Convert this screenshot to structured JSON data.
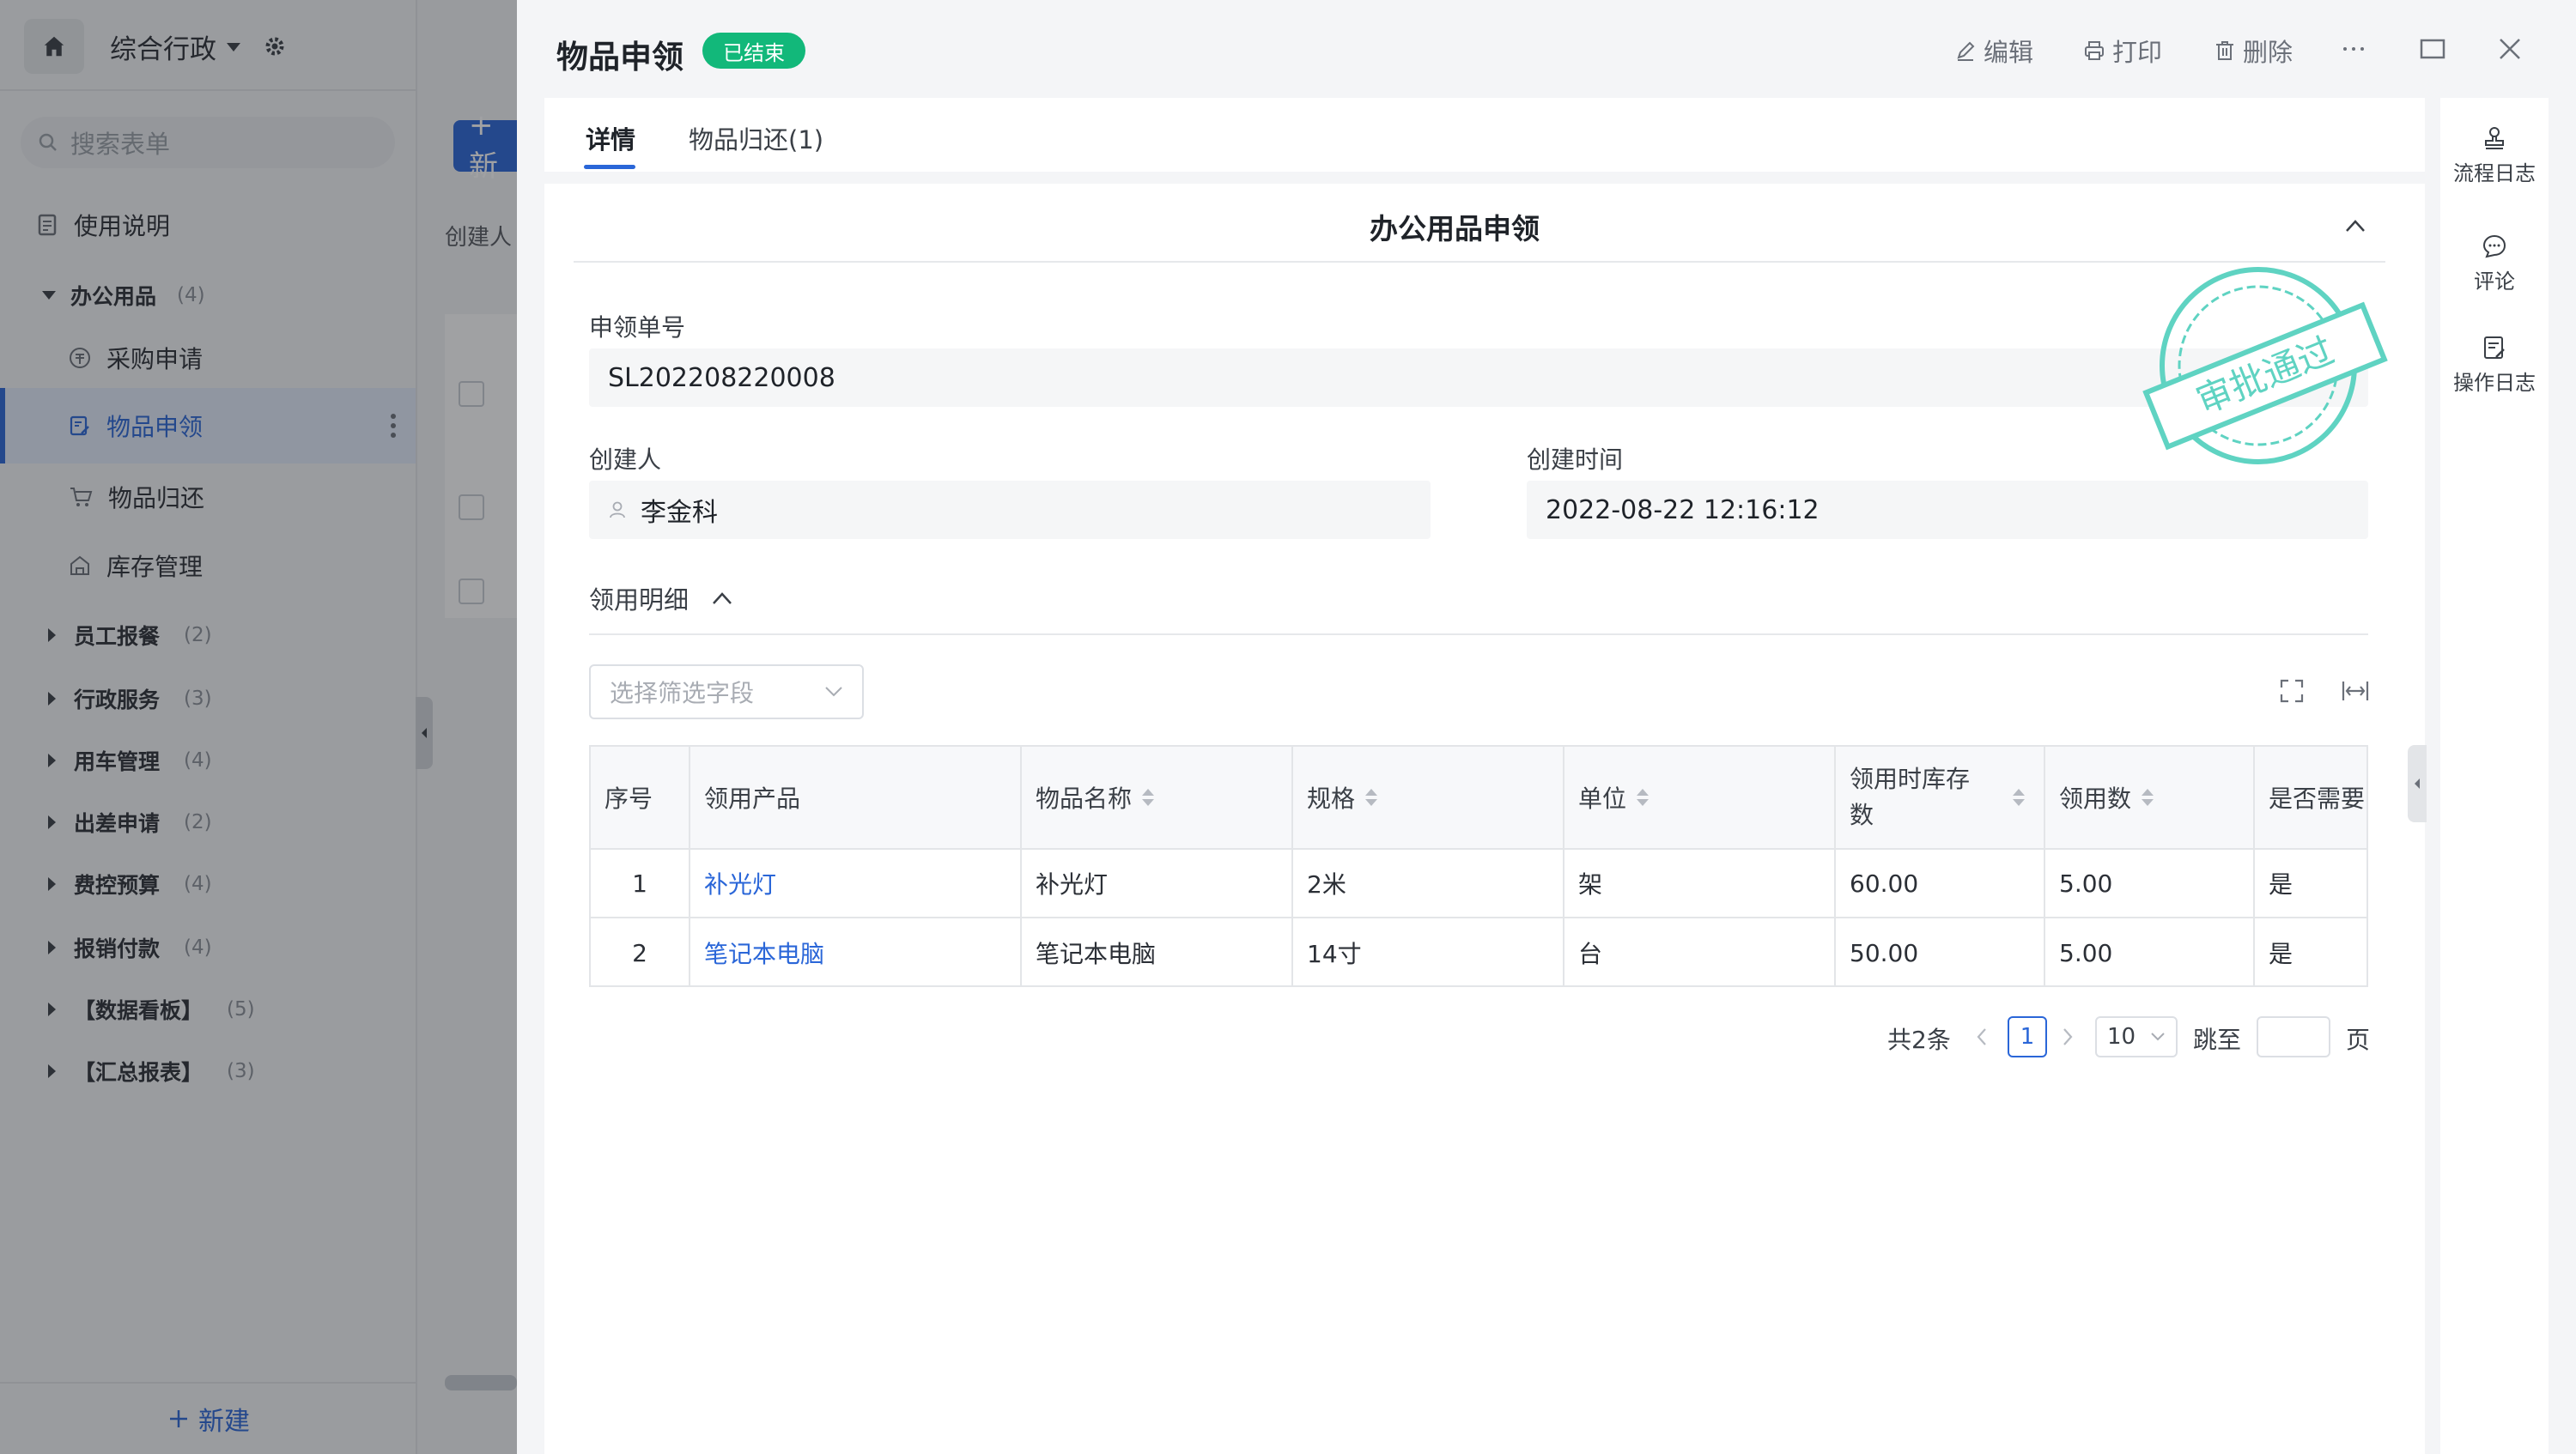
{
  "app": {
    "name": "综合行政",
    "search_placeholder": "搜索表单",
    "new_label": "新建"
  },
  "sidebar": {
    "items": [
      {
        "label": "使用说明",
        "type": "item",
        "icon": "doc-icon"
      },
      {
        "label": "办公用品",
        "count": "(4)",
        "type": "group",
        "expanded": true
      },
      {
        "label": "采购申请",
        "type": "child",
        "icon": "purchase-icon"
      },
      {
        "label": "物品申领",
        "type": "child",
        "icon": "apply-icon",
        "active": true
      },
      {
        "label": "物品归还",
        "type": "child",
        "icon": "cart-icon"
      },
      {
        "label": "库存管理",
        "type": "child",
        "icon": "warehouse-icon"
      },
      {
        "label": "员工报餐",
        "count": "(2)",
        "type": "group"
      },
      {
        "label": "行政服务",
        "count": "(3)",
        "type": "group"
      },
      {
        "label": "用车管理",
        "count": "(4)",
        "type": "group"
      },
      {
        "label": "出差申请",
        "count": "(2)",
        "type": "group"
      },
      {
        "label": "费控预算",
        "count": "(4)",
        "type": "group"
      },
      {
        "label": "报销付款",
        "count": "(4)",
        "type": "group"
      },
      {
        "label": "【数据看板】",
        "count": "(5)",
        "type": "group"
      },
      {
        "label": "【汇总报表】",
        "count": "(3)",
        "type": "group"
      }
    ]
  },
  "background_page": {
    "new_button": "+ 新",
    "creator_label": "创建人"
  },
  "drawer": {
    "title": "物品申领",
    "status": "已结束",
    "actions": {
      "edit": "编辑",
      "print": "打印",
      "delete": "删除"
    },
    "tabs": [
      {
        "label": "详情"
      },
      {
        "label": "物品归还(1)"
      }
    ],
    "section_title": "办公用品申领",
    "stamp_text": "审批通过",
    "fields": {
      "order_no": {
        "label": "申领单号",
        "value": "SL202208220008"
      },
      "creator": {
        "label": "创建人",
        "value": "李金科"
      },
      "created_at": {
        "label": "创建时间",
        "value": "2022-08-22 12:16:12"
      }
    },
    "detail": {
      "title": "领用明细",
      "filter_placeholder": "选择筛选字段",
      "columns": [
        "序号",
        "领用产品",
        "物品名称",
        "规格",
        "单位",
        "领用时库存数",
        "领用数",
        "是否需要!"
      ],
      "rows": [
        [
          "1",
          "补光灯",
          "补光灯",
          "2米",
          "架",
          "60.00",
          "5.00",
          "是"
        ],
        [
          "2",
          "笔记本电脑",
          "笔记本电脑",
          "14寸",
          "台",
          "50.00",
          "5.00",
          "是"
        ]
      ]
    },
    "pagination": {
      "total": "共2条",
      "current": "1",
      "page_size": "10",
      "jump_label": "跳至",
      "page_suffix": "页"
    },
    "rail": [
      {
        "label": "流程日志",
        "icon": "stamp-icon"
      },
      {
        "label": "评论",
        "icon": "comment-icon"
      },
      {
        "label": "操作日志",
        "icon": "log-icon"
      }
    ]
  },
  "colors": {
    "accent": "#2a66d8",
    "status_green": "#12b87a",
    "stamp_teal": "#5fd3c2"
  }
}
